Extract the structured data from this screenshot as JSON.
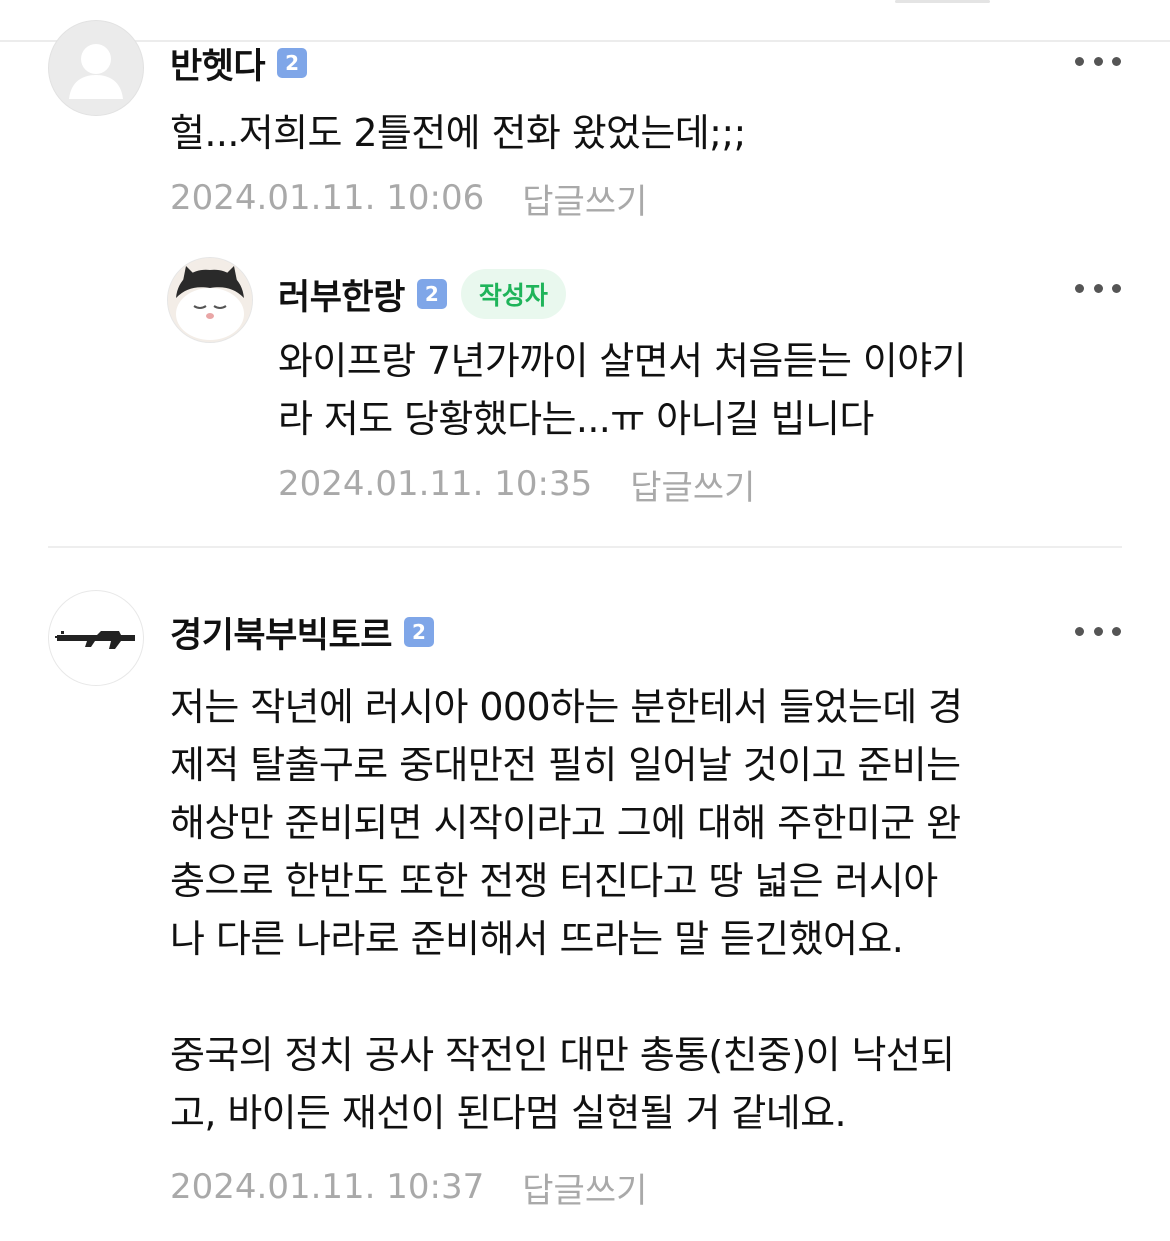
{
  "comments": [
    {
      "nickname": "반헷다",
      "level": "2",
      "text": "헐...저희도 2틀전에 전화 왔었는데;;;",
      "date": "2024.01.11. 10:06",
      "reply_label": "답글쓰기",
      "avatar_icon": "default-profile-icon"
    },
    {
      "nickname": "러부한랑",
      "level": "2",
      "author_badge": "작성자",
      "text": "와이프랑 7년가까이 살면서 처음듣는 이야기\n라 저도 당황했다는...ㅠ 아니길 빕니다",
      "date": "2024.01.11. 10:35",
      "reply_label": "답글쓰기",
      "avatar_icon": "cat-profile-icon"
    },
    {
      "nickname": "경기북부빅토르",
      "level": "2",
      "text": "저는 작년에 러시아 000하는 분한테서 들었는데 경\n제적 탈출구로 중대만전 필히 일어날 것이고 준비는\n해상만 준비되면 시작이라고 그에 대해 주한미군 완\n충으로 한반도 또한 전쟁 터진다고 땅 넓은 러시아\n나 다른 나라로 준비해서 뜨라는 말 듣긴했어요.\n\n중국의 정치 공사 작전인 대만 총통(친중)이 낙선되\n고, 바이든 재선이 된다멈 실현될 거 같네요.",
      "date": "2024.01.11. 10:37",
      "reply_label": "답글쓰기",
      "avatar_icon": "rifle-profile-icon"
    }
  ],
  "colors": {
    "level_badge": "#7fa6e8",
    "author_badge_bg": "#e9f8ee",
    "author_badge_text": "#1fb45a",
    "meta_text": "#a9a9a9"
  }
}
